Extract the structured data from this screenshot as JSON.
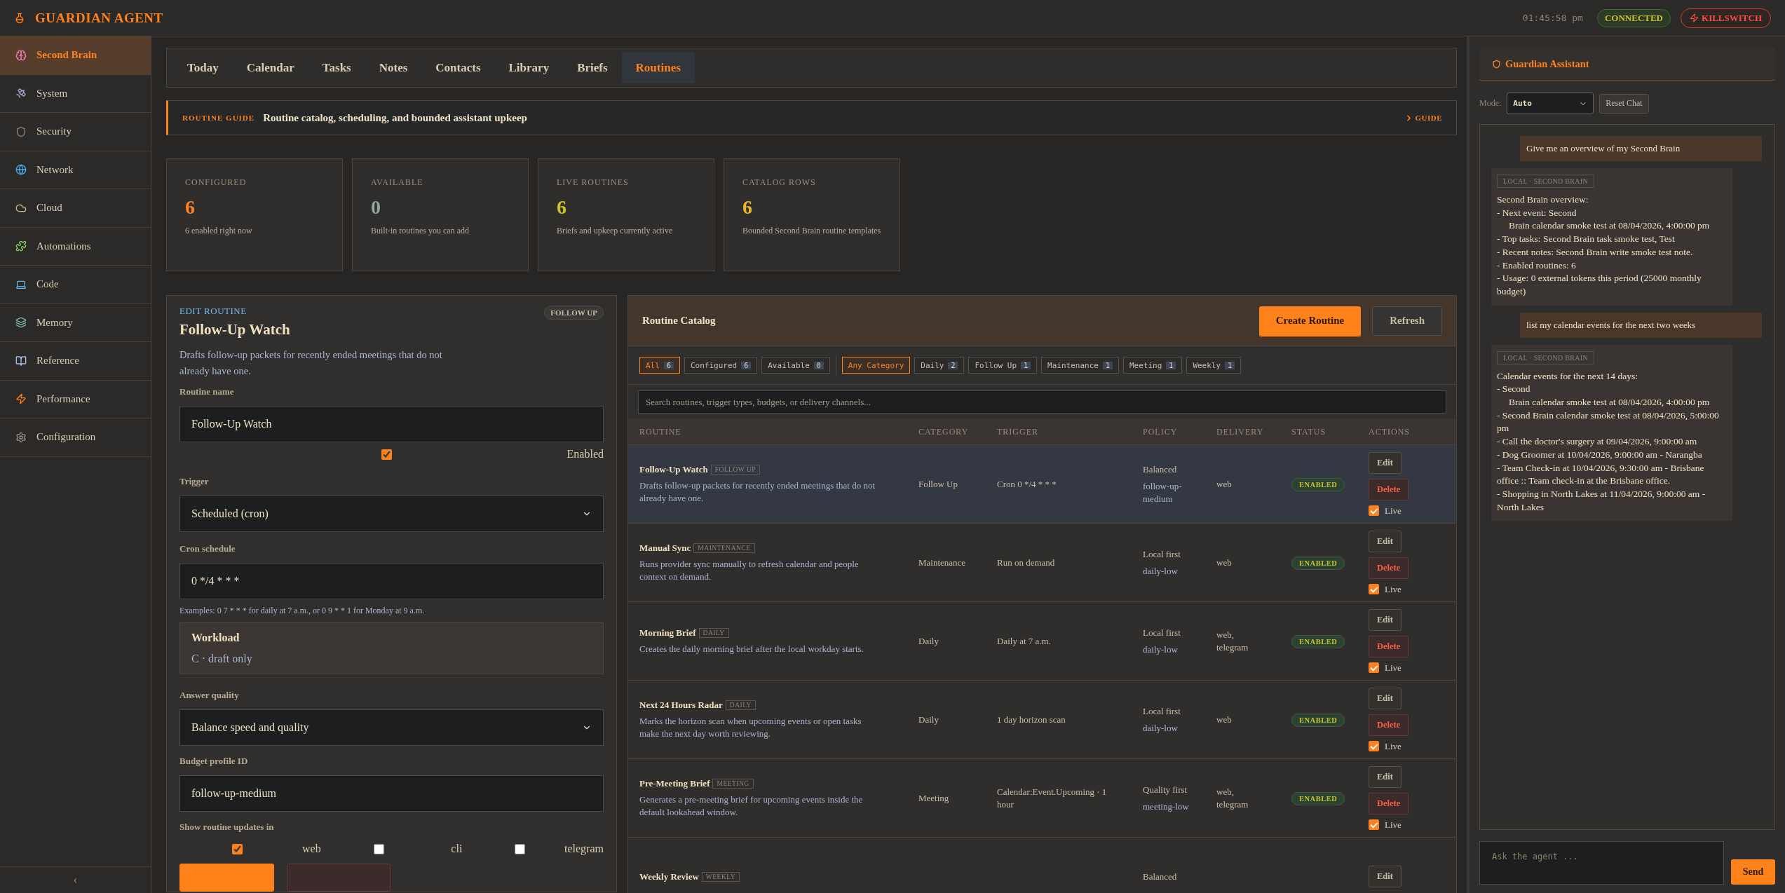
{
  "app": {
    "title": "GUARDIAN AGENT",
    "clock": "01:45:58 pm",
    "connection": "CONNECTED",
    "killswitch": "KILLSWITCH"
  },
  "sidebar": {
    "items": [
      {
        "label": "Second Brain",
        "selected": true
      },
      {
        "label": "System",
        "selected": false
      },
      {
        "label": "Security",
        "selected": false
      },
      {
        "label": "Network",
        "selected": false
      },
      {
        "label": "Cloud",
        "selected": false
      },
      {
        "label": "Automations",
        "selected": false
      },
      {
        "label": "Code",
        "selected": false
      },
      {
        "label": "Memory",
        "selected": false
      },
      {
        "label": "Reference",
        "selected": false
      },
      {
        "label": "Performance",
        "selected": false
      },
      {
        "label": "Configuration",
        "selected": false
      }
    ],
    "collapse": "‹"
  },
  "tabs": [
    {
      "label": "Today",
      "selected": false
    },
    {
      "label": "Calendar",
      "selected": false
    },
    {
      "label": "Tasks",
      "selected": false
    },
    {
      "label": "Notes",
      "selected": false
    },
    {
      "label": "Contacts",
      "selected": false
    },
    {
      "label": "Library",
      "selected": false
    },
    {
      "label": "Briefs",
      "selected": false
    },
    {
      "label": "Routines",
      "selected": true
    }
  ],
  "guide": {
    "eyebrow": "ROUTINE GUIDE",
    "text": "Routine catalog, scheduling, and bounded assistant upkeep",
    "link": "GUIDE"
  },
  "stats": [
    {
      "label": "CONFIGURED",
      "value": "6",
      "note": "6 enabled right now",
      "color": "#ff8119"
    },
    {
      "label": "AVAILABLE",
      "value": "0",
      "note": "Built-in routines you can add",
      "color": "#8fa89a"
    },
    {
      "label": "LIVE ROUTINES",
      "value": "6",
      "note": "Briefs and upkeep currently active",
      "color": "#c8c428"
    },
    {
      "label": "CATALOG ROWS",
      "value": "6",
      "note": "Bounded Second Brain routine templates",
      "color": "#f0b429"
    }
  ],
  "editor": {
    "eyebrow": "EDIT ROUTINE",
    "badge": "FOLLOW UP",
    "title": "Follow-Up Watch",
    "description": "Drafts follow-up packets for recently ended meetings that do not already have one.",
    "name_label": "Routine name",
    "name_value": "Follow-Up Watch",
    "enabled": {
      "label": "Enabled",
      "checked": true
    },
    "trigger_label": "Trigger",
    "trigger_value": "Scheduled (cron)",
    "cron_label": "Cron schedule",
    "cron_value": "0 */4 * * *",
    "cron_hint": "Examples: 0 7 * * * for daily at 7 a.m., or 0 9 * * 1 for Monday at 9 a.m.",
    "workload_title": "Workload",
    "workload_value": "C · draft only",
    "quality_label": "Answer quality",
    "quality_value": "Balance speed and quality",
    "budget_label": "Budget profile ID",
    "budget_value": "follow-up-medium",
    "channels_label": "Show routine updates in",
    "channels": [
      {
        "label": "web",
        "checked": true
      },
      {
        "label": "cli",
        "checked": false
      },
      {
        "label": "telegram",
        "checked": false
      }
    ]
  },
  "catalog": {
    "title": "Routine Catalog",
    "create": "Create Routine",
    "refresh": "Refresh",
    "scope_filters": [
      {
        "label": "All",
        "count": "6",
        "selected": true
      },
      {
        "label": "Configured",
        "count": "6",
        "selected": false
      },
      {
        "label": "Available",
        "count": "0",
        "selected": false
      }
    ],
    "category_filters": [
      {
        "label": "Any Category",
        "selected": true
      },
      {
        "label": "Daily",
        "count": "2",
        "selected": false
      },
      {
        "label": "Follow Up",
        "count": "1",
        "selected": false
      },
      {
        "label": "Maintenance",
        "count": "1",
        "selected": false
      },
      {
        "label": "Meeting",
        "count": "1",
        "selected": false
      },
      {
        "label": "Weekly",
        "count": "1",
        "selected": false
      }
    ],
    "search_placeholder": "Search routines, trigger types, budgets, or delivery channels...",
    "columns": [
      "ROUTINE",
      "CATEGORY",
      "TRIGGER",
      "POLICY",
      "DELIVERY",
      "STATUS",
      "ACTIONS"
    ],
    "rows": [
      {
        "name": "Follow-Up Watch",
        "tag": "FOLLOW UP",
        "description": "Drafts follow-up packets for recently ended meetings that do not already have one.",
        "category": "Follow Up",
        "trigger": "Cron 0 */4 * * *",
        "policy": "Balanced",
        "budget": "follow-up-medium",
        "delivery": "web",
        "status": "ENABLED",
        "actions": [
          "Edit",
          "Delete"
        ],
        "live": {
          "label": "Live",
          "checked": true
        },
        "selected": true
      },
      {
        "name": "Manual Sync",
        "tag": "MAINTENANCE",
        "description": "Runs provider sync manually to refresh calendar and people context on demand.",
        "category": "Maintenance",
        "trigger": "Run on demand",
        "policy": "Local first",
        "budget": "daily-low",
        "delivery": "web",
        "status": "ENABLED",
        "actions": [
          "Edit",
          "Delete"
        ],
        "live": {
          "label": "Live",
          "checked": true
        },
        "selected": false
      },
      {
        "name": "Morning Brief",
        "tag": "DAILY",
        "description": "Creates the daily morning brief after the local workday starts.",
        "category": "Daily",
        "trigger": "Daily at 7 a.m.",
        "policy": "Local first",
        "budget": "daily-low",
        "delivery": "web, telegram",
        "status": "ENABLED",
        "actions": [
          "Edit",
          "Delete"
        ],
        "live": {
          "label": "Live",
          "checked": true
        },
        "selected": false
      },
      {
        "name": "Next 24 Hours Radar",
        "tag": "DAILY",
        "description": "Marks the horizon scan when upcoming events or open tasks make the next day worth reviewing.",
        "category": "Daily",
        "trigger": "1 day horizon scan",
        "policy": "Local first",
        "budget": "daily-low",
        "delivery": "web",
        "status": "ENABLED",
        "actions": [
          "Edit",
          "Delete"
        ],
        "live": {
          "label": "Live",
          "checked": true
        },
        "selected": false
      },
      {
        "name": "Pre-Meeting Brief",
        "tag": "MEETING",
        "description": "Generates a pre-meeting brief for upcoming events inside the default lookahead window.",
        "category": "Meeting",
        "trigger": "Calendar:Event.Upcoming · 1 hour",
        "policy": "Quality first",
        "budget": "meeting-low",
        "delivery": "web, telegram",
        "status": "ENABLED",
        "actions": [
          "Edit",
          "Delete"
        ],
        "live": {
          "label": "Live",
          "checked": true
        },
        "selected": false
      },
      {
        "name": "Weekly Review",
        "tag": "WEEKLY",
        "policy": "Balanced",
        "actions": [
          "Edit"
        ],
        "selected": false
      }
    ]
  },
  "assistant": {
    "title": "Guardian Assistant",
    "mode_label": "Mode:",
    "mode_value": "Auto",
    "reset": "Reset Chat",
    "messages": [
      {
        "kind": "user",
        "text": "Give me an overview of my Second Brain"
      },
      {
        "kind": "assistant",
        "source": "LOCAL · SECOND BRAIN",
        "lines": [
          "Second Brain overview:",
          "- Next event: Second",
          "     Brain calendar smoke test at 08/04/2026, 4:00:00 pm",
          "- Top tasks: Second Brain task smoke test, Test",
          "- Recent notes: Second Brain write smoke test note.",
          "- Enabled routines: 6",
          "- Usage: 0 external tokens this period (25000 monthly budget)"
        ]
      },
      {
        "kind": "user",
        "text": "list my calendar events for the next two weeks"
      },
      {
        "kind": "assistant",
        "source": "LOCAL · SECOND BRAIN",
        "lines": [
          "Calendar events for the next 14 days:",
          "- Second",
          "     Brain calendar smoke test at 08/04/2026, 4:00:00 pm",
          "- Second Brain calendar smoke test at 08/04/2026, 5:00:00 pm",
          "- Call the doctor's surgery at 09/04/2026, 9:00:00 am",
          "- Dog Groomer at 10/04/2026, 9:00:00 am - Narangba",
          "- Team Check-in at 10/04/2026, 9:30:00 am - Brisbane office :: Team check-in at the Brisbane office.",
          "- Shopping in North Lakes at 11/04/2026, 9:00:00 am - North Lakes"
        ]
      }
    ],
    "input_placeholder": "Ask the agent ...",
    "send": "Send"
  }
}
